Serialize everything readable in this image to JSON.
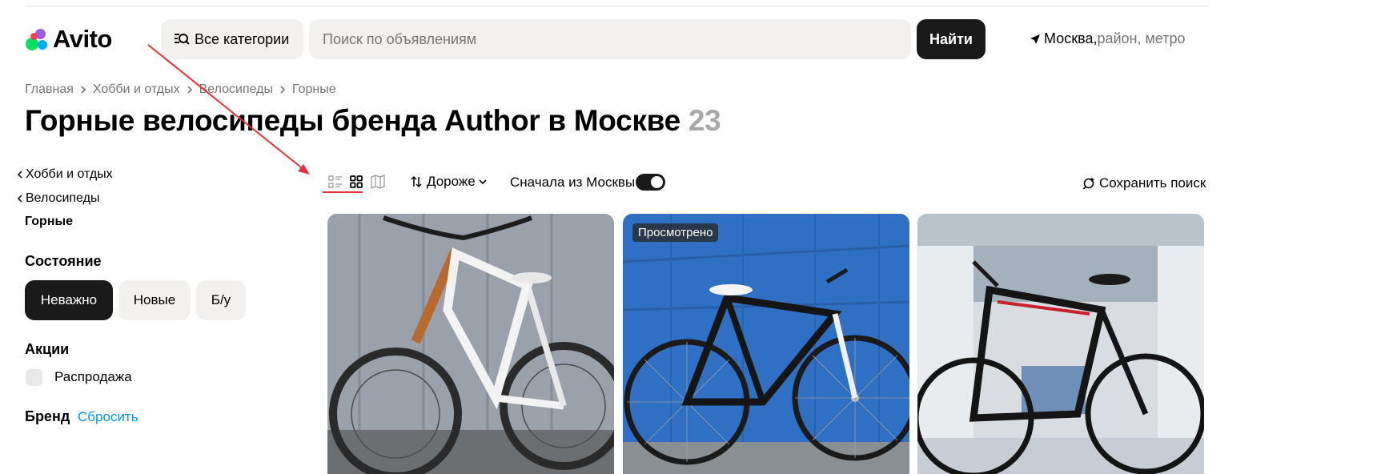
{
  "header": {
    "logo_text": "Avito",
    "categories_label": "Все категории",
    "search_placeholder": "Поиск по объявлениям",
    "find_label": "Найти",
    "location_city": "Москва,",
    "location_sub": " район, метро"
  },
  "breadcrumbs": [
    "Главная",
    "Хобби и отдых",
    "Велосипеды",
    "Горные"
  ],
  "title": {
    "text": "Горные велосипеды бренда Author в Москве",
    "count": "23"
  },
  "sidebar": {
    "parent_links": [
      "Хобби и отдых",
      "Велосипеды"
    ],
    "current": "Горные",
    "condition": {
      "title": "Состояние",
      "options": [
        "Неважно",
        "Новые",
        "Б/у"
      ],
      "selected": "Неважно"
    },
    "promos": {
      "title": "Акции",
      "checkbox_label": "Распродажа",
      "checked": false
    },
    "brand": {
      "title": "Бренд",
      "reset_label": "Сбросить"
    }
  },
  "toolbar": {
    "view_modes": [
      "list-view-icon",
      "grid-view-icon",
      "map-view-icon"
    ],
    "active_view": "grid-view-icon",
    "sort_label": "Дороже",
    "moscow_first_label": "Сначала из Москвы",
    "moscow_first_on": true,
    "save_search_label": "Сохранить поиск"
  },
  "listings": [
    {
      "badge": ""
    },
    {
      "badge": "Просмотрено"
    },
    {
      "badge": ""
    }
  ],
  "colors": {
    "accent_dark": "#1a1a1a",
    "chip_bg": "#f2f1f0",
    "link_blue": "#0099f7",
    "annotation_red": "#e3303c"
  }
}
